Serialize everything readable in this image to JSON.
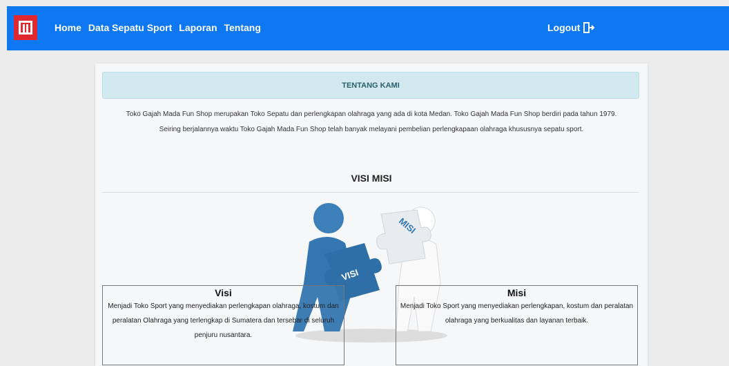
{
  "nav": {
    "items": [
      "Home",
      "Data Sepatu Sport",
      "Laporan",
      "Tentang"
    ],
    "logout_label": "Logout"
  },
  "colors": {
    "topbar": "#0d78f2",
    "logo": "#e0282e",
    "about_header_bg": "#d1e9ef"
  },
  "about": {
    "header": "TENTANG KAMI",
    "line1": "Toko Gajah Mada Fun Shop merupakan Toko Sepatu dan perlengkapan olahraga yang ada di kota Medan. Toko Gajah Mada Fun Shop berdiri pada tahun 1979.",
    "line2": "Seiring berjalannya waktu Toko Gajah Mada Fun Shop telah banyak melayani pembelian perlengkapaan olahraga khususnya sepatu sport."
  },
  "visi_misi": {
    "title": "VISI MISI",
    "puzzle_left_label": "VISI",
    "puzzle_right_label": "MISI",
    "visi": {
      "heading": "Visi",
      "text": "Menjadi Toko Sport yang menyediakan perlengkapan olahraga, kostum dan peralatan Olahraga yang terlengkap di Sumatera dan tersebar di seluruh penjuru nusantara."
    },
    "misi": {
      "heading": "Misi",
      "text": "Menjadi Toko Sport yang menyediakan perlengkapan, kostum dan peralatan olahraga yang berkualitas dan layanan terbaik."
    }
  }
}
